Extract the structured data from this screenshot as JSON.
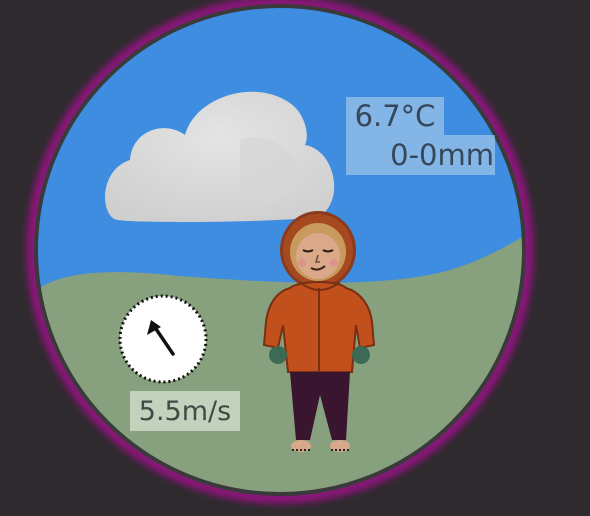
{
  "weather": {
    "temperature": "6.7°C",
    "precipitation": "0-0mm",
    "wind_speed": "5.5m/s"
  },
  "wind_direction": {
    "icon": "arrow-up-left-icon"
  },
  "scene": {
    "sky": "cloud-icon",
    "character": "person-in-winter-parka"
  },
  "colors": {
    "ring": "#b3159e",
    "sky": "#3f8de0",
    "grass": "#87a07e",
    "jacket": "#c2501d",
    "background": "#2e2a2e"
  }
}
